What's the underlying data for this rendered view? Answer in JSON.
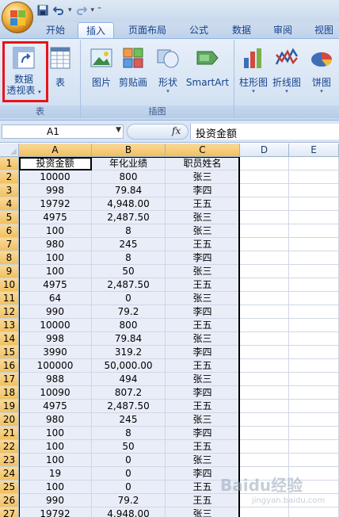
{
  "quick_access": {
    "icons": [
      "save-icon",
      "undo-icon",
      "redo-icon",
      "customize-icon"
    ]
  },
  "tabs": [
    {
      "label": "开始",
      "active": false
    },
    {
      "label": "插入",
      "active": true
    },
    {
      "label": "页面布局",
      "active": false
    },
    {
      "label": "公式",
      "active": false
    },
    {
      "label": "数据",
      "active": false
    },
    {
      "label": "审阅",
      "active": false
    },
    {
      "label": "视图",
      "active": false
    }
  ],
  "ribbon": {
    "groups": [
      {
        "label": "表",
        "buttons": [
          {
            "label_line1": "数据",
            "label_line2": "透视表",
            "icon": "pivot-table-icon"
          },
          {
            "label": "表",
            "icon": "table-icon"
          }
        ]
      },
      {
        "label": "插图",
        "buttons": [
          {
            "label": "图片",
            "icon": "picture-icon"
          },
          {
            "label": "剪贴画",
            "icon": "clipart-icon"
          },
          {
            "label": "形状",
            "icon": "shapes-icon"
          },
          {
            "label": "SmartArt",
            "icon": "smartart-icon"
          }
        ]
      },
      {
        "label": "",
        "buttons": [
          {
            "label": "柱形图",
            "icon": "column-chart-icon"
          },
          {
            "label": "折线图",
            "icon": "line-chart-icon"
          },
          {
            "label": "饼图",
            "icon": "pie-chart-icon"
          }
        ]
      }
    ]
  },
  "formula_bar": {
    "cell_ref": "A1",
    "fx_label": "fx",
    "value": "投资金额"
  },
  "sheet": {
    "columns": [
      "A",
      "B",
      "C",
      "D",
      "E"
    ],
    "header_row": [
      "投资金额",
      "年化业绩",
      "职员姓名"
    ],
    "rows": [
      [
        "10000",
        "800",
        "张三"
      ],
      [
        "998",
        "79.84",
        "李四"
      ],
      [
        "19792",
        "4,948.00",
        "王五"
      ],
      [
        "4975",
        "2,487.50",
        "张三"
      ],
      [
        "100",
        "8",
        "张三"
      ],
      [
        "980",
        "245",
        "王五"
      ],
      [
        "100",
        "8",
        "李四"
      ],
      [
        "100",
        "50",
        "张三"
      ],
      [
        "4975",
        "2,487.50",
        "王五"
      ],
      [
        "64",
        "0",
        "张三"
      ],
      [
        "990",
        "79.2",
        "李四"
      ],
      [
        "10000",
        "800",
        "王五"
      ],
      [
        "998",
        "79.84",
        "张三"
      ],
      [
        "3990",
        "319.2",
        "李四"
      ],
      [
        "100000",
        "50,000.00",
        "王五"
      ],
      [
        "988",
        "494",
        "张三"
      ],
      [
        "10090",
        "807.2",
        "李四"
      ],
      [
        "4975",
        "2,487.50",
        "王五"
      ],
      [
        "980",
        "245",
        "张三"
      ],
      [
        "100",
        "8",
        "李四"
      ],
      [
        "100",
        "50",
        "王五"
      ],
      [
        "100",
        "0",
        "张三"
      ],
      [
        "19",
        "0",
        "李四"
      ],
      [
        "100",
        "0",
        "王五"
      ],
      [
        "990",
        "79.2",
        "王五"
      ],
      [
        "19792",
        "4,948.00",
        "张三"
      ]
    ]
  },
  "watermark": {
    "logo_text": "Baidu经验",
    "url": "jingyan.baidu.com"
  }
}
